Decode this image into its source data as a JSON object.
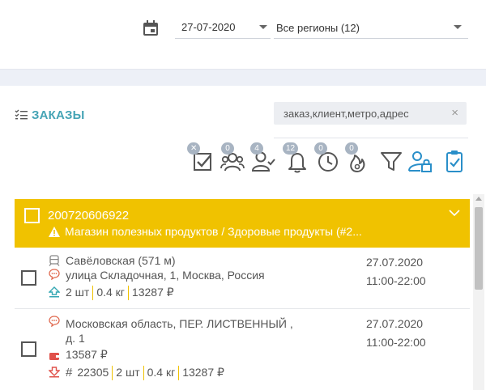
{
  "filters": {
    "calendar_icon": "calendar-icon",
    "date_value": "27-07-2020",
    "region_value": "Все регионы (12)"
  },
  "section": {
    "title": "ЗАКАЗЫ",
    "title_icon": "checklist-icon",
    "search_placeholder": "заказ,клиент,метро,адрес"
  },
  "toolbar": {
    "items": [
      {
        "icon": "checkbox-check-icon",
        "badge": "✕"
      },
      {
        "icon": "users-group-icon",
        "badge": "0"
      },
      {
        "icon": "user-check-icon",
        "badge": "4"
      },
      {
        "icon": "bell-icon",
        "badge": "12"
      },
      {
        "icon": "clock-icon",
        "badge": "0"
      },
      {
        "icon": "fire-icon",
        "badge": "0"
      },
      {
        "icon": "filter-icon",
        "badge": ""
      },
      {
        "icon": "user-lock-icon",
        "badge": ""
      },
      {
        "icon": "clipboard-check-icon",
        "badge": ""
      }
    ],
    "accent_color": "#2a8fc9",
    "icon_color": "#555555",
    "badge_color": "#a8b4c2"
  },
  "group": {
    "number": "200720606922",
    "shop": "Магазин полезных продуктов / Здоровые продукты (#2...",
    "color": "#f0c200"
  },
  "orders": [
    {
      "metro": "Савёловская (571 м)",
      "address": "улица Складочная, 1, Москва, Россия",
      "qty": "2 шт",
      "weight": "0.4 кг",
      "sum": "13287 ₽",
      "date": "27.07.2020",
      "time": "11:00-22:00"
    },
    {
      "address_line1": "Московская область, ПЕР. ЛИСТВЕННЫЙ ,",
      "address_line2": "д. 1",
      "payment": "13587 ₽",
      "order_no": "22305",
      "qty": "2 шт",
      "weight": "0.4 кг",
      "sum": "13287 ₽",
      "date": "27.07.2020",
      "time": "11:00-22:00"
    }
  ]
}
